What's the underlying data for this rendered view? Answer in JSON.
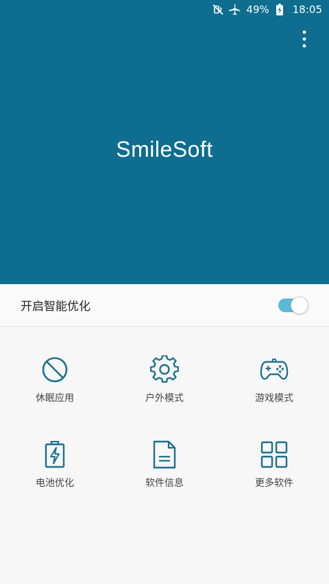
{
  "status_bar": {
    "mute_icon": "mute-vibrate-icon",
    "airplane_icon": "airplane-icon",
    "battery_percent": "49%",
    "battery_icon": "battery-charging-icon",
    "time": "18:05"
  },
  "header": {
    "title": "SmileSoft",
    "menu_icon": "more-vertical-icon",
    "background_color": "#0f6d8f"
  },
  "smart_optimize": {
    "label": "开启智能优化",
    "enabled": true,
    "accent_color": "#5ab9d8"
  },
  "features": [
    {
      "label": "休眠应用",
      "icon": "block-icon"
    },
    {
      "label": "户外模式",
      "icon": "gear-icon"
    },
    {
      "label": "游戏模式",
      "icon": "gamepad-icon"
    },
    {
      "label": "电池优化",
      "icon": "battery-bolt-icon"
    },
    {
      "label": "软件信息",
      "icon": "document-icon"
    },
    {
      "label": "更多软件",
      "icon": "grid-icon"
    }
  ],
  "icon_color": "#1a6f8e"
}
